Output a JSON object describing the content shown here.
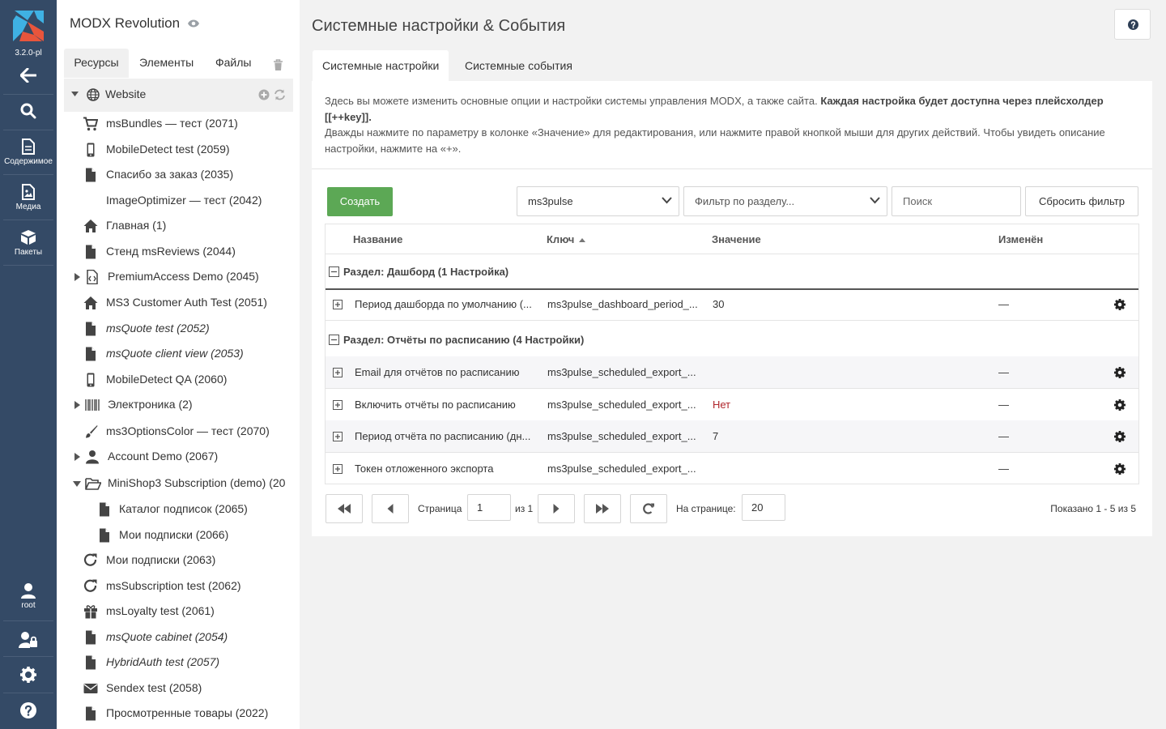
{
  "app": {
    "version": "3.2.0-pl",
    "site_name": "MODX Revolution",
    "colors": {
      "navbar": "#344a66",
      "create_button": "#5ca855",
      "logo_blue": "#3fb1e3",
      "logo_orange": "#e8553c",
      "value_red": "#b0252b"
    }
  },
  "navbar": {
    "items": [
      {
        "icon": "arrow-left-icon",
        "label": ""
      },
      {
        "icon": "search-icon",
        "label": ""
      },
      {
        "icon": "document-icon",
        "label": "Содержимое"
      },
      {
        "icon": "media-icon",
        "label": "Медиа"
      },
      {
        "icon": "package-icon",
        "label": "Пакеты"
      }
    ],
    "bottom": [
      {
        "icon": "user-icon",
        "label": "root"
      },
      {
        "icon": "user-lock-icon",
        "label": ""
      },
      {
        "icon": "gear-icon",
        "label": ""
      },
      {
        "icon": "question-icon",
        "label": ""
      }
    ]
  },
  "tree": {
    "tabs": [
      "Ресурсы",
      "Элементы",
      "Файлы"
    ],
    "root": "Website",
    "items": [
      {
        "label": "msBundles — тест (2071)",
        "icon": "cart-icon",
        "italic": false,
        "caret": false,
        "indent": 0
      },
      {
        "label": "MobileDetect test (2059)",
        "icon": "mobile-icon",
        "italic": false,
        "caret": false,
        "indent": 0
      },
      {
        "label": "Спасибо за заказ (2035)",
        "icon": "file-icon",
        "italic": false,
        "caret": false,
        "indent": 0
      },
      {
        "label": "ImageOptimizer — тест (2042)",
        "icon": "",
        "italic": false,
        "caret": false,
        "indent": 0
      },
      {
        "label": "Главная (1)",
        "icon": "home-icon",
        "italic": false,
        "caret": false,
        "indent": 0
      },
      {
        "label": "Стенд msReviews (2044)",
        "icon": "file-icon",
        "italic": false,
        "caret": false,
        "indent": 0
      },
      {
        "label": "PremiumAccess Demo (2045)",
        "icon": "file-code-icon",
        "italic": false,
        "caret": true,
        "open": false,
        "indent": 0
      },
      {
        "label": "MS3 Customer Auth Test (2051)",
        "icon": "home-icon",
        "italic": false,
        "caret": false,
        "indent": 0
      },
      {
        "label": "msQuote test (2052)",
        "icon": "file-icon",
        "italic": true,
        "caret": false,
        "indent": 0
      },
      {
        "label": "msQuote client view (2053)",
        "icon": "file-icon",
        "italic": true,
        "caret": false,
        "indent": 0
      },
      {
        "label": "MobileDetect QA (2060)",
        "icon": "mobile-icon",
        "italic": false,
        "caret": false,
        "indent": 0
      },
      {
        "label": "Электроника (2)",
        "icon": "barcode-icon",
        "italic": false,
        "caret": true,
        "open": false,
        "indent": 0
      },
      {
        "label": "ms3OptionsColor — тест (2070)",
        "icon": "brush-icon",
        "italic": false,
        "caret": false,
        "indent": 0
      },
      {
        "label": "Account Demo (2067)",
        "icon": "user-icon",
        "italic": false,
        "caret": true,
        "open": false,
        "indent": 0
      },
      {
        "label": "MiniShop3 Subscription (demo) (20",
        "icon": "folder-open-icon",
        "italic": false,
        "caret": true,
        "open": true,
        "indent": 0
      },
      {
        "label": "Каталог подписок (2065)",
        "icon": "file-icon",
        "italic": false,
        "caret": false,
        "indent": 1
      },
      {
        "label": "Мои подписки (2066)",
        "icon": "file-icon",
        "italic": false,
        "caret": false,
        "indent": 1
      },
      {
        "label": "Мои подписки (2063)",
        "icon": "redo-icon",
        "italic": false,
        "caret": false,
        "indent": 0
      },
      {
        "label": "msSubscription test (2062)",
        "icon": "redo-icon",
        "italic": false,
        "caret": false,
        "indent": 0
      },
      {
        "label": "msLoyalty test (2061)",
        "icon": "gift-icon",
        "italic": false,
        "caret": false,
        "indent": 0
      },
      {
        "label": "msQuote cabinet (2054)",
        "icon": "file-icon",
        "italic": true,
        "caret": false,
        "indent": 0
      },
      {
        "label": "HybridAuth test (2057)",
        "icon": "file-icon",
        "italic": true,
        "caret": false,
        "indent": 0
      },
      {
        "label": "Sendex test (2058)",
        "icon": "envelope-icon",
        "italic": false,
        "caret": false,
        "indent": 0
      },
      {
        "label": "Просмотренные товары (2022)",
        "icon": "file-icon",
        "italic": false,
        "caret": false,
        "indent": 0
      }
    ]
  },
  "main": {
    "title": "Системные настройки & События",
    "tabs": [
      "Системные настройки",
      "Системные события"
    ],
    "desc1": "Здесь вы можете изменить основные опции и настройки системы управления MODX, а также сайта. ",
    "desc1_bold": "Каждая настройка будет доступна через плейсхолдер [[++key]].",
    "desc2": "Дважды нажмите по параметру в колонке «Значение» для редактирования, или нажмите правой кнопкой мыши для других действий. Чтобы увидеть описание настройки, нажмите на «+».",
    "toolbar": {
      "create": "Создать",
      "namespace": "ms3pulse",
      "area_placeholder": "Фильтр по разделу...",
      "search_placeholder": "Поиск",
      "reset": "Сбросить фильтр"
    },
    "grid": {
      "columns": [
        "Название",
        "Ключ",
        "Значение",
        "Изменён"
      ],
      "groups": [
        {
          "title": "Раздел: Дашборд (1 Настройка)",
          "rows": [
            {
              "name": "Период дашборда по умолчанию (...",
              "key": "ms3pulse_dashboard_period_...",
              "value": "30",
              "value_red": false,
              "edited": "—"
            }
          ]
        },
        {
          "title": "Раздел: Отчёты по расписанию (4 Настройки)",
          "rows": [
            {
              "name": "Email для отчётов по расписанию",
              "key": "ms3pulse_scheduled_export_...",
              "value": "",
              "value_red": false,
              "edited": "—"
            },
            {
              "name": "Включить отчёты по расписанию",
              "key": "ms3pulse_scheduled_export_...",
              "value": "Нет",
              "value_red": true,
              "edited": "—"
            },
            {
              "name": "Период отчёта по расписанию (дн...",
              "key": "ms3pulse_scheduled_export_...",
              "value": "7",
              "value_red": false,
              "edited": "—"
            },
            {
              "name": "Токен отложенного экспорта",
              "key": "ms3pulse_scheduled_export_...",
              "value": "",
              "value_red": false,
              "edited": "—"
            }
          ]
        }
      ]
    },
    "pager": {
      "page_label": "Страница",
      "page": "1",
      "of_label": "из 1",
      "per_page_label": "На странице:",
      "per_page": "20",
      "shown": "Показано 1 - 5 из 5"
    }
  }
}
